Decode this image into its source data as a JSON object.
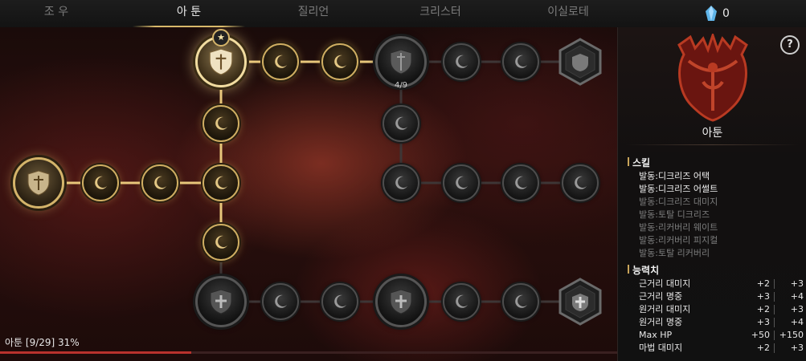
{
  "tabs": [
    {
      "label": "조 우",
      "active": false
    },
    {
      "label": "아 툰",
      "active": true
    },
    {
      "label": "질리언",
      "active": false
    },
    {
      "label": "크리스터",
      "active": false
    },
    {
      "label": "이실로테",
      "active": false
    }
  ],
  "currency": {
    "icon": "blue-crystal-icon",
    "count": "0"
  },
  "tree": {
    "mid_node_count": "4/9",
    "progress_label": "아툰 [9/29] 31%",
    "progress_fraction": 0.31
  },
  "panel": {
    "help_label": "?",
    "class_name": "아툰",
    "skills_title": "스킬",
    "skills": [
      {
        "label": "발동:디크리즈 어택",
        "active": true
      },
      {
        "label": "발동:디크리즈 어썰트",
        "active": true
      },
      {
        "label": "발동:디크리즈 대미지",
        "active": false
      },
      {
        "label": "발동:토탈 디크리즈",
        "active": false
      },
      {
        "label": "발동:리커버리 웨이트",
        "active": false
      },
      {
        "label": "발동:리커버리 피지컬",
        "active": false
      },
      {
        "label": "발동:토탈 리커버리",
        "active": false
      }
    ],
    "stats_title": "능력치",
    "stats": [
      {
        "label": "근거리 대미지",
        "current": "+2",
        "next": "+3"
      },
      {
        "label": "근거리 명중",
        "current": "+3",
        "next": "+4"
      },
      {
        "label": "원거리 대미지",
        "current": "+2",
        "next": "+3"
      },
      {
        "label": "원거리 명중",
        "current": "+3",
        "next": "+4"
      },
      {
        "label": "Max HP",
        "current": "+50",
        "next": "+150"
      },
      {
        "label": "마법 대미지",
        "current": "+2",
        "next": "+3"
      }
    ]
  },
  "colors": {
    "accent_gold": "#d4b46a",
    "progress_red": "#b8322d",
    "crystal_blue": "#5fb4e8"
  }
}
